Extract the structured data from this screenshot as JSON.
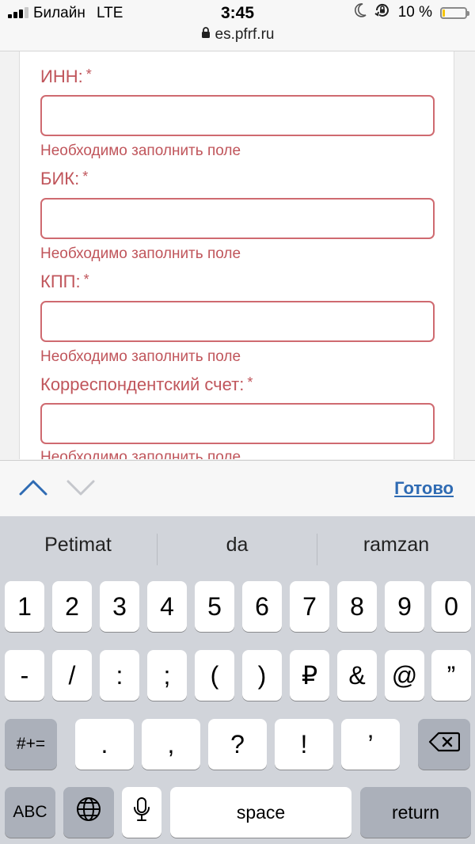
{
  "status_bar": {
    "carrier": "Билайн",
    "network": "LTE",
    "time": "3:45",
    "url": "es.pfrf.ru",
    "battery_text": "10 %",
    "battery_level": 0.1,
    "icons": [
      "signal-icon",
      "lock-icon",
      "moon-icon",
      "orientation-lock-icon",
      "battery-icon"
    ]
  },
  "form": {
    "fields": [
      {
        "label": "ИНН:",
        "required_mark": "*",
        "value": "",
        "error": "Необходимо заполнить поле"
      },
      {
        "label": "БИК:",
        "required_mark": "*",
        "value": "",
        "error": "Необходимо заполнить поле"
      },
      {
        "label": "КПП:",
        "required_mark": "*",
        "value": "",
        "error": "Необходимо заполнить поле"
      },
      {
        "label": "Корреспондентский счет:",
        "required_mark": "*",
        "value": "",
        "error": "Необходимо заполнить поле"
      }
    ],
    "colors": {
      "error": "#c0555b",
      "border": "#cf6a70"
    }
  },
  "accessory_bar": {
    "done_label": "Готово",
    "icons": [
      "chevron-up-icon",
      "chevron-down-icon"
    ],
    "link_color": "#2f6bb3"
  },
  "keyboard": {
    "suggestions": [
      "Petimat",
      "da",
      "ramzan"
    ],
    "row1": [
      "1",
      "2",
      "3",
      "4",
      "5",
      "6",
      "7",
      "8",
      "9",
      "0"
    ],
    "row2": [
      "-",
      "/",
      ":",
      ";",
      "(",
      ")",
      "₽",
      "&",
      "@",
      "”"
    ],
    "row3_left": "#+=",
    "row3_keys": [
      ".",
      ",",
      "?",
      "!",
      "’"
    ],
    "row4": {
      "abc": "ABC",
      "space": "space",
      "return": "return"
    },
    "icons": [
      "globe-icon",
      "microphone-icon",
      "backspace-icon"
    ]
  }
}
